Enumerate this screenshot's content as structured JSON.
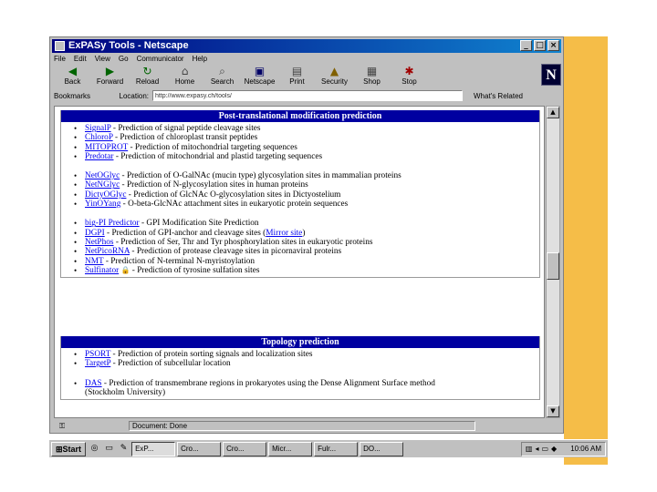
{
  "window": {
    "title": "ExPASy  Tools - Netscape",
    "controls": {
      "minimize": "_",
      "maximize": "□",
      "close": "×"
    }
  },
  "menu": [
    "File",
    "Edit",
    "View",
    "Go",
    "Communicator",
    "Help"
  ],
  "toolbar": [
    {
      "label": "Back",
      "icon": "back-arrow-icon"
    },
    {
      "label": "Forward",
      "icon": "forward-arrow-icon"
    },
    {
      "label": "Reload",
      "icon": "reload-icon"
    },
    {
      "label": "Home",
      "icon": "home-icon"
    },
    {
      "label": "Search",
      "icon": "search-icon"
    },
    {
      "label": "Netscape",
      "icon": "netscape-icon"
    },
    {
      "label": "Print",
      "icon": "print-icon"
    },
    {
      "label": "Security",
      "icon": "security-icon"
    },
    {
      "label": "Shop",
      "icon": "shop-icon"
    },
    {
      "label": "Stop",
      "icon": "stop-icon"
    }
  ],
  "logo": "N",
  "location": {
    "bookmarks": "Bookmarks",
    "label": "Location:",
    "url": "http://www.expasy.ch/tools/",
    "related": "What's Related"
  },
  "sections": [
    {
      "title": "Post-translational modification prediction",
      "items": [
        {
          "link": "SignalP",
          "desc": " - Prediction of signal peptide cleavage sites"
        },
        {
          "link": "ChloroP",
          "desc": " - Prediction of chloroplast transit peptides"
        },
        {
          "link": "MITOPROT",
          "desc": " - Prediction of mitochondrial targeting sequences"
        },
        {
          "link": "Predotar",
          "desc": " - Prediction of mitochondrial and plastid targeting sequences"
        },
        {
          "gap": true
        },
        {
          "link": "NetOGlyc",
          "desc": " - Prediction of O-GalNAc (mucin type) glycosylation sites in mammalian proteins"
        },
        {
          "link": "NetNGlyc",
          "desc": " - Prediction of N-glycosylation sites in human proteins"
        },
        {
          "link": "DictyOGlyc",
          "desc": " - Prediction of GlcNAc O-glycosylation sites in Dictyostelium"
        },
        {
          "link": "YinOYang",
          "desc": " - O-beta-GlcNAc attachment sites in eukaryotic protein sequences"
        },
        {
          "gap": true
        },
        {
          "link": "big-PI Predictor",
          "desc": " - GPI Modification Site Prediction"
        },
        {
          "link": "DGPI",
          "desc": " - Prediction of GPI-anchor and cleavage sites (",
          "link2": "Mirror site",
          "desc2": ")"
        },
        {
          "link": "NetPhos",
          "desc": " - Prediction of Ser, Thr and Tyr phosphorylation sites in eukaryotic proteins"
        },
        {
          "link": "NetPicoRNA",
          "desc": " - Prediction of protease cleavage sites in picornaviral proteins"
        },
        {
          "link": "NMT",
          "desc": " - Prediction of N-terminal N-myristoylation"
        },
        {
          "link": "Sulfinator",
          "lock": "🔒",
          "desc": " - Prediction of tyrosine sulfation sites"
        }
      ]
    },
    {
      "title": "Topology prediction",
      "items": [
        {
          "link": "PSORT",
          "desc": " - Prediction of protein sorting signals and localization sites"
        },
        {
          "link": "TargetP",
          "desc": " - Prediction of subcellular location"
        },
        {
          "gap": true
        },
        {
          "link": "DAS",
          "desc": " - Prediction of transmembrane regions in prokaryotes using the Dense Alignment Surface method"
        },
        {
          "cont": "(Stockholm University)"
        }
      ]
    }
  ],
  "status": {
    "text": "Document: Done"
  },
  "taskbar": {
    "start": "Start",
    "tasks": [
      "ExP...",
      "Cro...",
      "Cro...",
      "Micr...",
      "Fulr...",
      "DO..."
    ],
    "clock": "10:06 AM"
  },
  "colors": {
    "accent": "#f5bd48",
    "section_header": "#0000a0",
    "title_bar": "#000080",
    "link": "#0000ee"
  }
}
